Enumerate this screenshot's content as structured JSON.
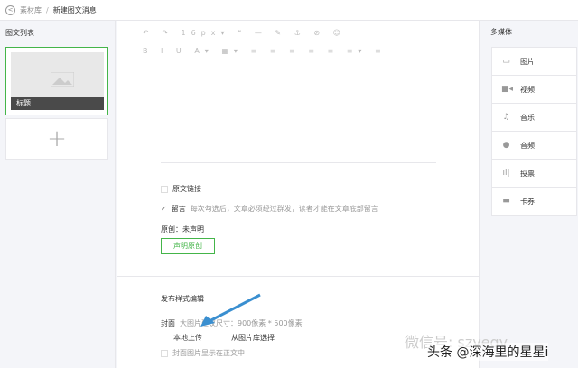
{
  "breadcrumb": {
    "parent": "素材库",
    "separator": "/",
    "current": "新建图文消息"
  },
  "left": {
    "title": "图文列表",
    "card_title": "标题",
    "add": "+"
  },
  "toolbar": {
    "row1": "↶ ↷ 16px▾ ❝ — ✎ ⚓ ⊘ ☺",
    "row2": "B I U A▾ ▦▾ ≡ ≡ ≡ ≡ ≡ ≡▾ ≡"
  },
  "options": {
    "source_link": "原文链接",
    "comment": "留言",
    "comment_hint": "每次勾选后，文章必须经过群发，读者才能在文章底部留言",
    "original": "原创：未声明",
    "declare_btn": "声明原创"
  },
  "publish": {
    "title": "发布样式编辑",
    "cover": "封面",
    "cover_hint": "大图片建议尺寸：900像素 * 500像素",
    "upload_local": "本地上传",
    "from_library": "从图片库选择",
    "show_in_body": "封面图片显示在正文中"
  },
  "media": {
    "title": "多媒体",
    "items": [
      {
        "label": "图片",
        "icon": "image-icon"
      },
      {
        "label": "视频",
        "icon": "video-icon"
      },
      {
        "label": "音乐",
        "icon": "music-icon"
      },
      {
        "label": "音频",
        "icon": "microphone-icon"
      },
      {
        "label": "投票",
        "icon": "poll-icon"
      },
      {
        "label": "卡券",
        "icon": "card-icon"
      }
    ]
  },
  "watermark": {
    "wechat": "微信号: szyeqy",
    "toutiao": "头条 @深海里的星星i"
  },
  "colors": {
    "accent": "#44b549"
  }
}
